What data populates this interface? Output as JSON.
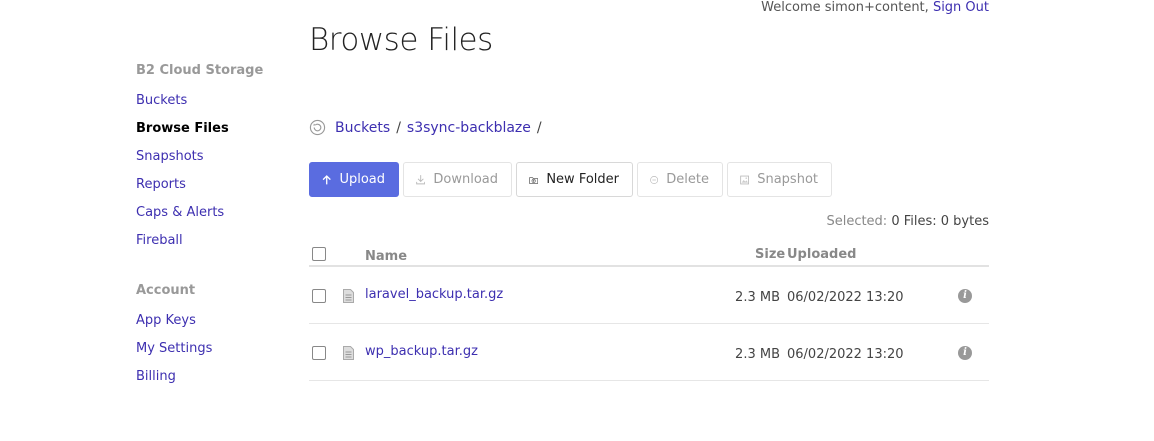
{
  "header": {
    "welcome_text": "Welcome simon+content,",
    "sign_out": "Sign Out"
  },
  "sidebar": {
    "section_storage": "B2 Cloud Storage",
    "storage_items": [
      {
        "label": "Buckets",
        "active": false
      },
      {
        "label": "Browse Files",
        "active": true
      },
      {
        "label": "Snapshots",
        "active": false
      },
      {
        "label": "Reports",
        "active": false
      },
      {
        "label": "Caps & Alerts",
        "active": false
      },
      {
        "label": "Fireball",
        "active": false
      }
    ],
    "section_account": "Account",
    "account_items": [
      {
        "label": "App Keys"
      },
      {
        "label": "My Settings"
      },
      {
        "label": "Billing"
      }
    ]
  },
  "main": {
    "title": "Browse Files",
    "breadcrumb": {
      "root": "Buckets",
      "separator": "/",
      "bucket": "s3sync-backblaze",
      "trailing": "/"
    },
    "toolbar": {
      "upload": "Upload",
      "download": "Download",
      "new_folder": "New Folder",
      "delete": "Delete",
      "snapshot": "Snapshot"
    },
    "selection": {
      "label": "Selected:",
      "value": "0 Files: 0 bytes"
    },
    "table": {
      "columns": {
        "name": "Name",
        "size": "Size",
        "uploaded": "Uploaded"
      },
      "rows": [
        {
          "name": "laravel_backup.tar.gz",
          "size": "2.3 MB",
          "uploaded": "06/02/2022 13:20"
        },
        {
          "name": "wp_backup.tar.gz",
          "size": "2.3 MB",
          "uploaded": "06/02/2022 13:20"
        }
      ]
    }
  },
  "colors": {
    "link": "#3d2fb0",
    "primary_button": "#5a6ce0"
  },
  "icons": {
    "refresh": "refresh-icon",
    "upload": "arrow-up-icon",
    "download": "download-icon",
    "new_folder": "folder-plus-icon",
    "delete": "minus-circle-icon",
    "snapshot": "image-icon",
    "file": "file-icon",
    "info": "info-icon"
  }
}
